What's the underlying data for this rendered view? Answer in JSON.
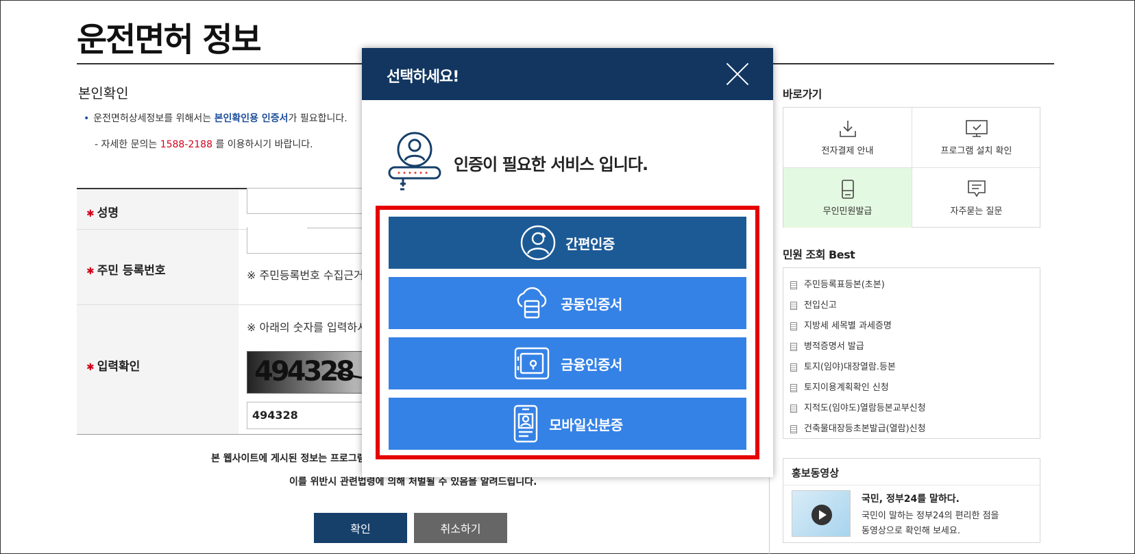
{
  "page": {
    "title": "운전면허 정보",
    "section_title": "본인확인",
    "note1_prefix": "운전면허상세정보를 위해서는 ",
    "note1_highlight": "본인확인용 인증서",
    "note1_suffix": "가 필요합니다.",
    "note2_prefix": "- 자세한 문의는 ",
    "note2_phone": "1588-2188",
    "note2_suffix": " 를 이용하시기 바랍니다."
  },
  "form": {
    "name_label": "성명",
    "rrn_label": "주민 등록번호",
    "rrn_hint": "※ 주민등록번호 수집근거",
    "captcha_label": "입력확인",
    "captcha_hint": "※ 아래의 숫자를 입력하시",
    "captcha_image_text": "494328",
    "captcha_input_value": "494328"
  },
  "footer": {
    "line1": "본 웹사이트에 게시된 정보는 프로그램",
    "line2": "이를 위반시 관련법령에 의해 처벌될 수 있음을 알려드립니다.",
    "confirm_label": "확인",
    "cancel_label": "취소하기"
  },
  "sidebar": {
    "quick_title": "바로가기",
    "quick_items": [
      {
        "label": "전자결제 안내",
        "icon": "download-icon"
      },
      {
        "label": "프로그램 설치 확인",
        "icon": "monitor-check-icon"
      },
      {
        "label": "무인민원발급",
        "icon": "kiosk-icon"
      },
      {
        "label": "자주묻는 질문",
        "icon": "faq-icon"
      }
    ],
    "best_title": "민원 조회 Best",
    "best_items": [
      "주민등록표등본(초본)",
      "전입신고",
      "지방세 세목별 과세증명",
      "병적증명서 발급",
      "토지(임야)대장열람.등본",
      "토지이용계획확인 신청",
      "지적도(임야도)열람등본교부신청",
      "건축물대장등초본발급(열람)신청"
    ],
    "promo_title": "홍보동영상",
    "promo_headline": "국민, 정부24를 말하다.",
    "promo_desc1": "국민이 말하는 정부24의 편리한 점을",
    "promo_desc2": "동영상으로 확인해 보세요."
  },
  "modal": {
    "title": "선택하세요!",
    "message": "인증이 필요한 서비스 입니다.",
    "options": [
      {
        "label": "간편인증",
        "icon": "person-circle-icon"
      },
      {
        "label": "공동인증서",
        "icon": "cloud-certificate-icon"
      },
      {
        "label": "금융인증서",
        "icon": "safe-icon"
      },
      {
        "label": "모바일신분증",
        "icon": "mobile-id-icon"
      }
    ]
  },
  "colors": {
    "modal_header": "#12365f",
    "option_primary": "#1c5a96",
    "option_secondary": "#3582e6",
    "highlight_box": "#e60000",
    "accent_blue": "#1d4e9b",
    "accent_red": "#d0021b"
  }
}
